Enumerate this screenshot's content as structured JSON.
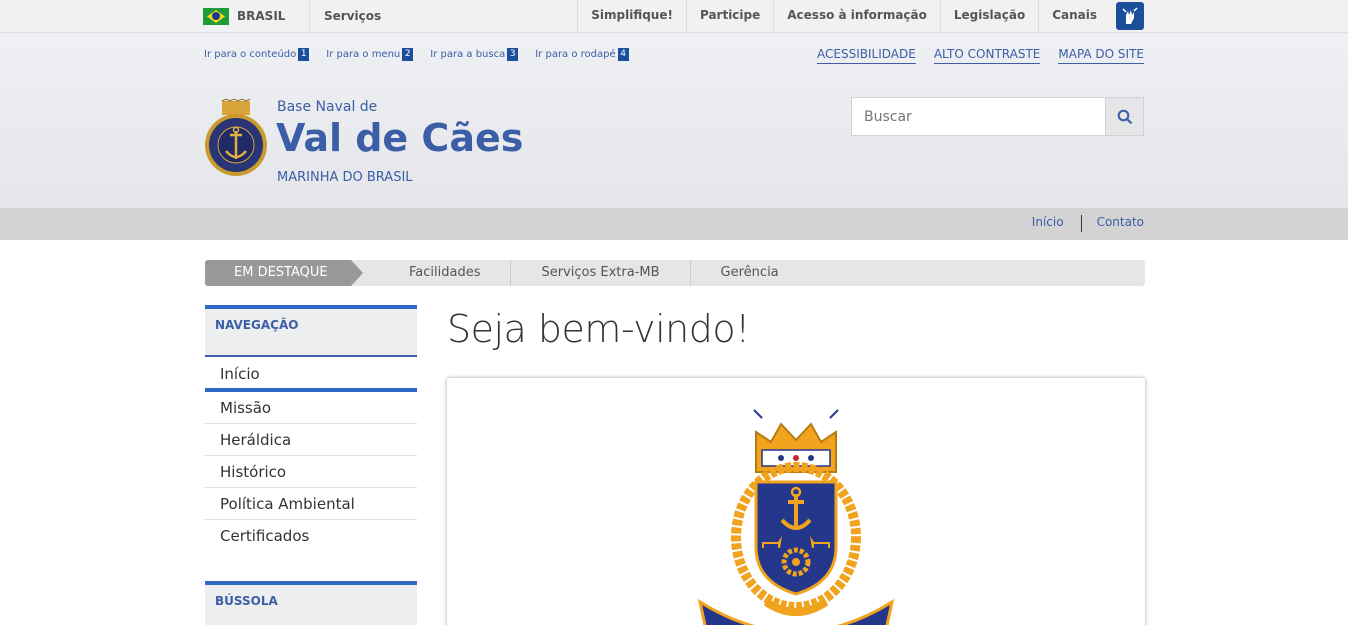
{
  "govbar": {
    "country": "BRASIL",
    "services": "Serviços",
    "links": [
      "Simplifique!",
      "Participe",
      "Acesso à informação",
      "Legislação",
      "Canais"
    ]
  },
  "header": {
    "access_keys": [
      {
        "label": "Ir para o conteúdo",
        "key": "1"
      },
      {
        "label": "Ir para o menu",
        "key": "2"
      },
      {
        "label": "Ir para a busca",
        "key": "3"
      },
      {
        "label": "Ir para o rodapé",
        "key": "4"
      }
    ],
    "top_links": [
      "ACESSIBILIDADE",
      "ALTO CONTRASTE",
      "MAPA DO SITE"
    ],
    "site_pre": "Base Naval de",
    "site_title": "Val de Cães",
    "site_sub": "MARINHA DO BRASIL",
    "search_placeholder": "Buscar"
  },
  "subbar": {
    "links": [
      "Início",
      "Contato"
    ]
  },
  "destaque": {
    "label": "EM DESTAQUE",
    "links": [
      "Facilidades",
      "Serviços Extra-MB",
      "Gerência"
    ]
  },
  "sidebar": {
    "nav_title": "NAVEGAÇÃO",
    "items": [
      "Início",
      "Missão",
      "Heráldica",
      "Histórico",
      "Política Ambiental",
      "Certificados"
    ],
    "bussola_title": "BÚSSOLA"
  },
  "main": {
    "title": "Seja bem-vindo!"
  },
  "colors": {
    "primary": "#3b5ea6",
    "accent_blue": "#2f69c6",
    "gold": "#f1a31e",
    "navy": "#25378a"
  }
}
